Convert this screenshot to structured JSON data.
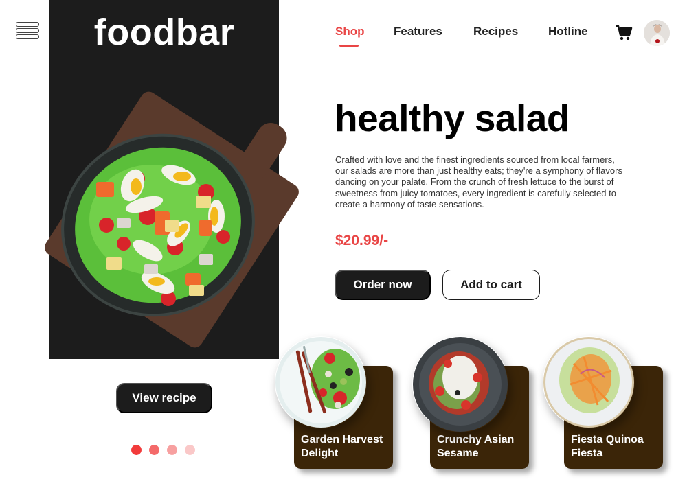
{
  "brand": {
    "logo_text": "foodbar"
  },
  "nav": {
    "items": [
      {
        "label": "Shop",
        "active": true
      },
      {
        "label": "Features",
        "active": false
      },
      {
        "label": "Recipes",
        "active": false
      },
      {
        "label": "Hotline",
        "active": false
      }
    ],
    "icons": {
      "menu": "hamburger-menu-icon",
      "cart": "shopping-cart-icon",
      "avatar": "user-avatar"
    }
  },
  "hero": {
    "title": "healthy salad",
    "description": "Crafted with love and the finest ingredients sourced from local farmers, our salads are more than just healthy eats; they're a symphony of flavors dancing on your palate. From the crunch of fresh lettuce to the burst of sweetness from juicy tomatoes, every ingredient is carefully selected to create a harmony of taste sensations.",
    "price": "$20.99/-",
    "order_label": "Order now",
    "add_to_cart_label": "Add to cart",
    "view_recipe_label": "View recipe",
    "image": "salad-bowl-on-wooden-board"
  },
  "carousel": {
    "dot_count": 4,
    "active_index": 0,
    "dot_colors": [
      "#f23b3b",
      "#f46a6a",
      "#f7a0a0",
      "#fac8c8"
    ]
  },
  "products": [
    {
      "name": "Garden Harvest Delight",
      "image": "garden-salad-plate"
    },
    {
      "name": "Crunchy Asian Sesame",
      "image": "asian-sesame-salad-plate"
    },
    {
      "name": "Fiesta Quinoa Fiesta",
      "image": "quinoa-salad-plate"
    }
  ],
  "colors": {
    "accent": "#e94545",
    "dark": "#1c1c1c",
    "card_brown": "#3b2508"
  }
}
